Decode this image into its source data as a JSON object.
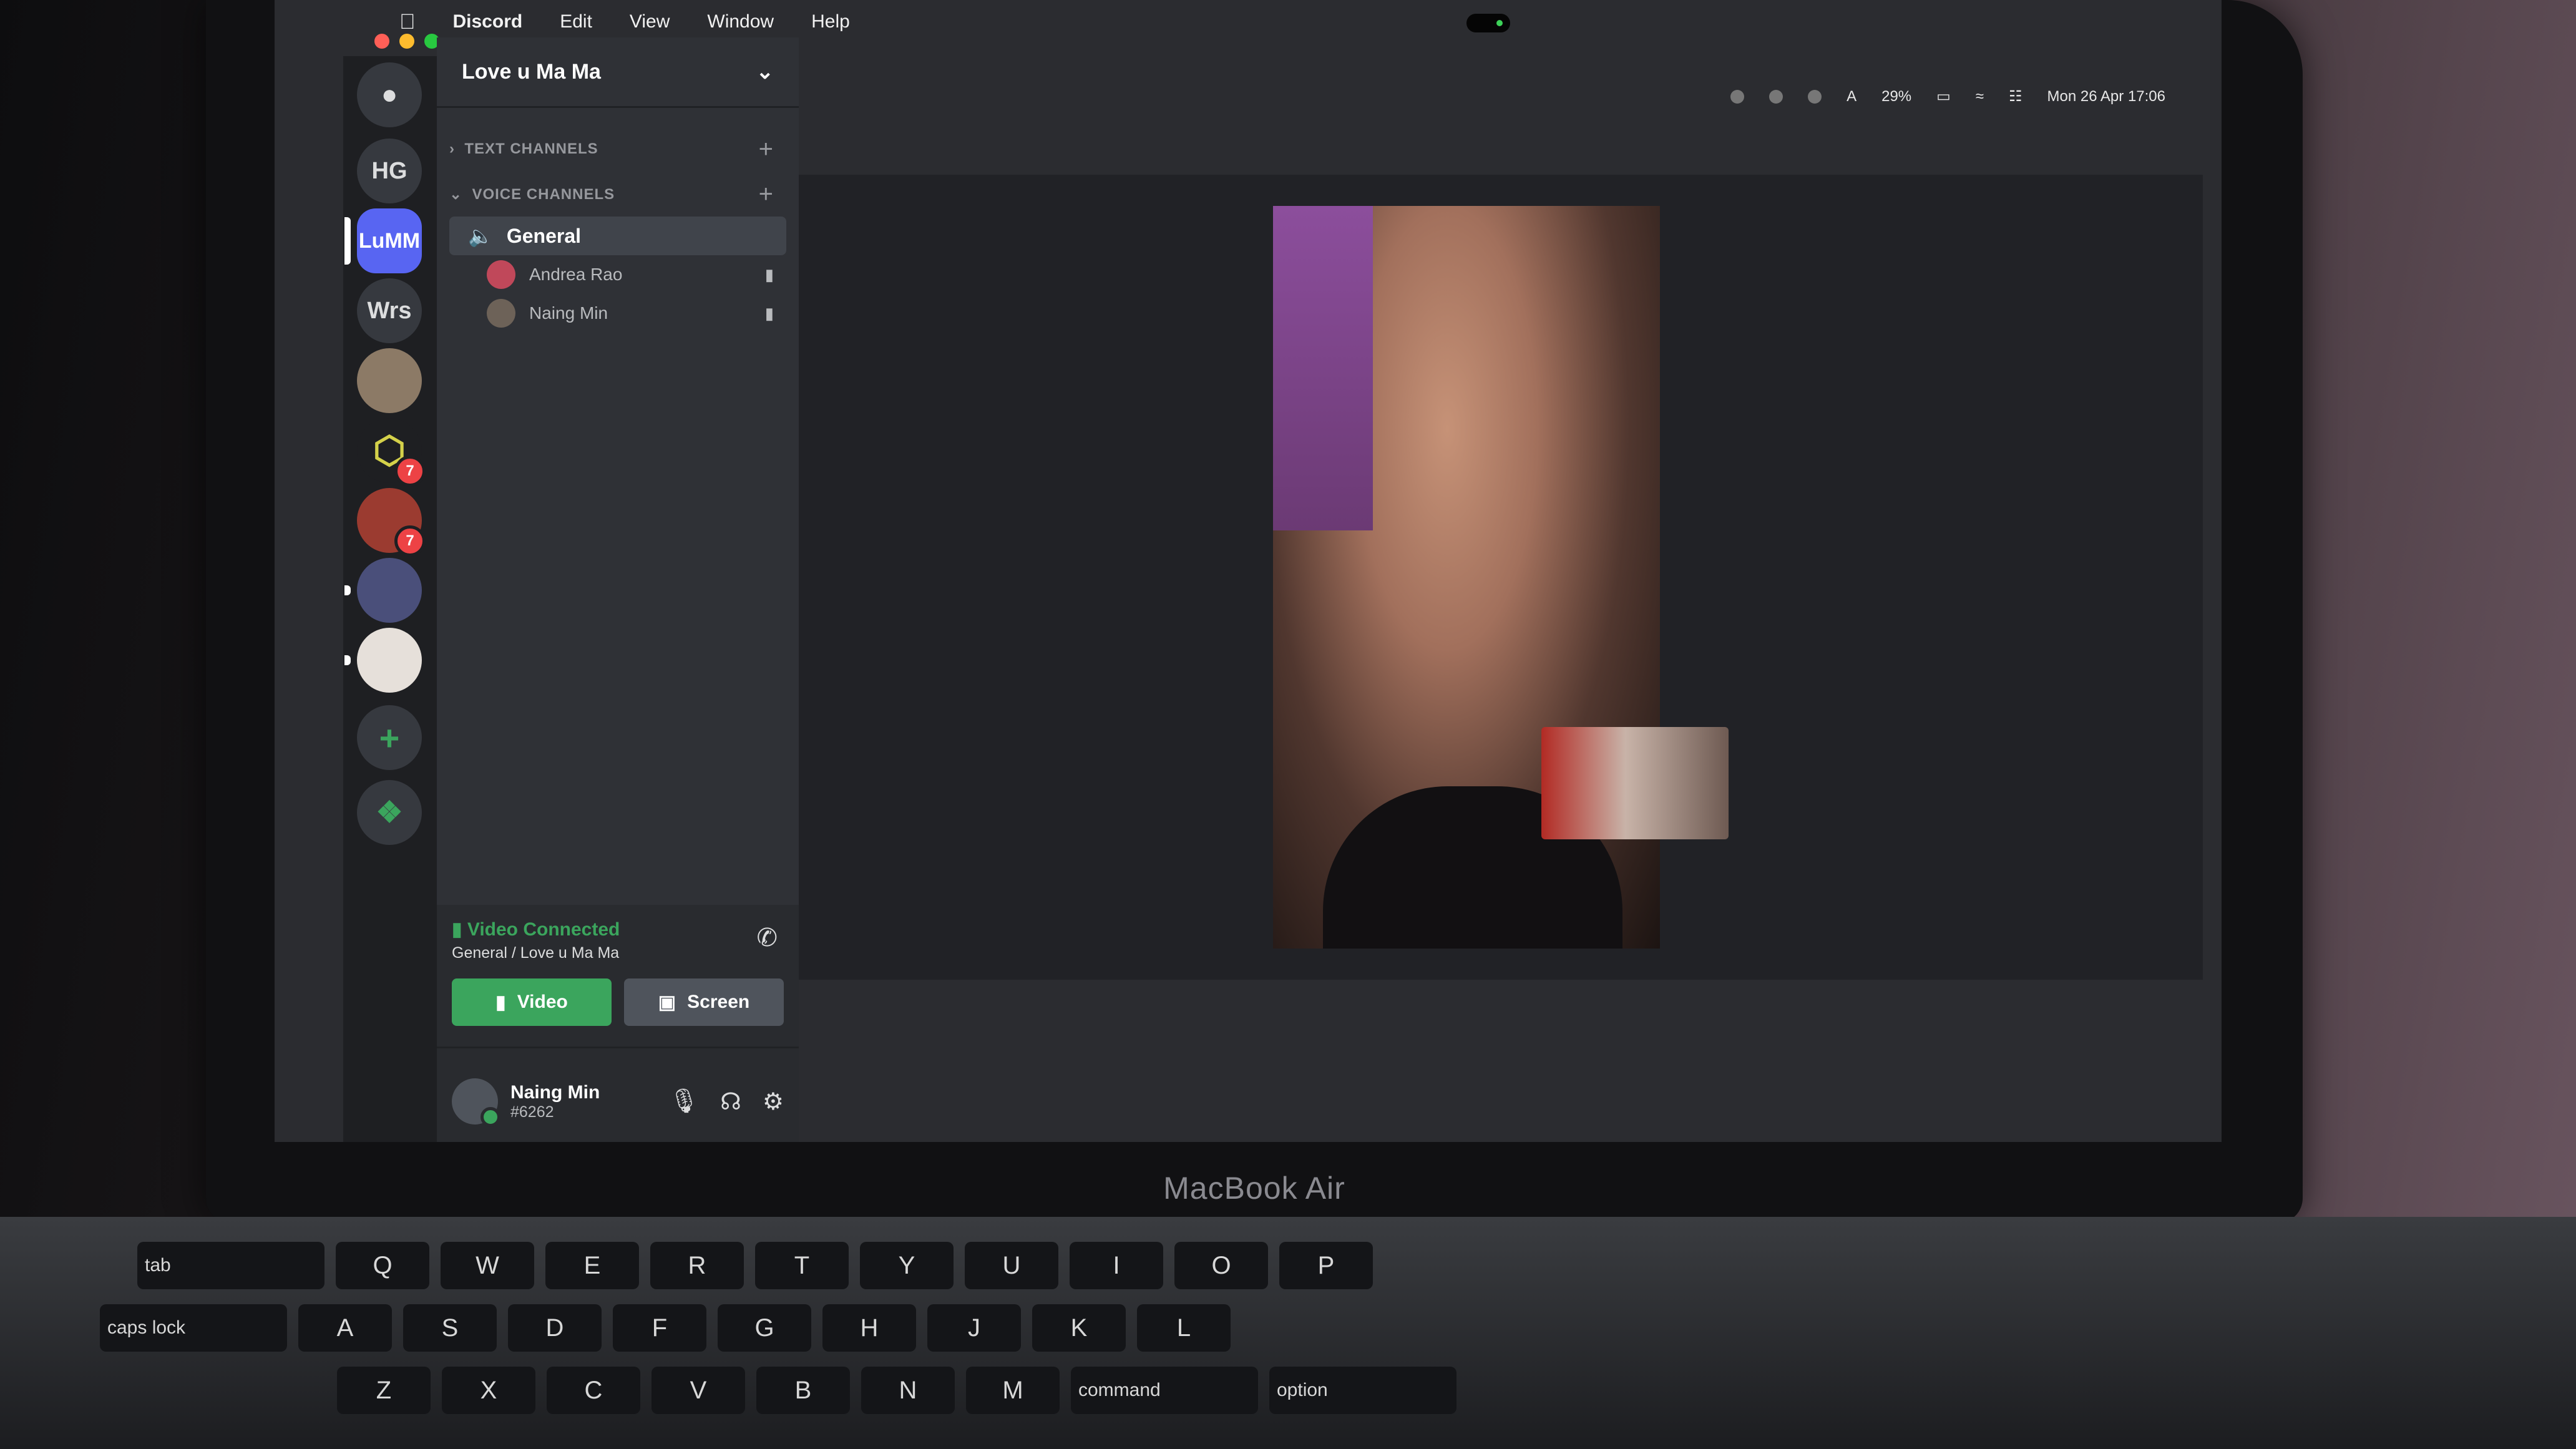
{
  "menu_bar": {
    "apple": "",
    "app_name": "Discord",
    "items": [
      "Edit",
      "View",
      "Window",
      "Help"
    ]
  },
  "status_bar": {
    "battery": "29%",
    "datetime": "Mon 26 Apr 17:06"
  },
  "servers": [
    {
      "label": "HG"
    },
    {
      "label": "LuMM",
      "active": true
    },
    {
      "label": "Wrs"
    },
    {
      "label": "",
      "badge": ""
    },
    {
      "label": "",
      "badge": "7"
    },
    {
      "label": "",
      "badge": "7"
    }
  ],
  "guild": {
    "name": "Love u Ma Ma"
  },
  "channels": {
    "text_category": "TEXT CHANNELS",
    "voice_category": "VOICE CHANNELS",
    "voice_channel": "General",
    "members": [
      "Andrea Rao",
      "Naing Min"
    ]
  },
  "rtc": {
    "status": "Video Connected",
    "location": "General / Love u Ma Ma",
    "video_label": "Video",
    "screen_label": "Screen"
  },
  "user": {
    "name": "Naing Min",
    "tag": "#6262"
  },
  "device": {
    "brand": "MacBook Air"
  },
  "keyboard": {
    "row1": [
      "tab",
      "Q",
      "W",
      "E",
      "R",
      "T",
      "Y",
      "U",
      "I",
      "O",
      "P"
    ],
    "row2": [
      "caps lock",
      "A",
      "S",
      "D",
      "F",
      "G",
      "H",
      "J",
      "K",
      "L"
    ],
    "row3": [
      "Z",
      "X",
      "C",
      "V",
      "B",
      "N",
      "M",
      "command",
      "option"
    ]
  },
  "colors": {
    "accent": "#5865f2",
    "connected": "#3ba55d",
    "video_button": "#3ba55d",
    "screen_button": "#4f545c"
  }
}
